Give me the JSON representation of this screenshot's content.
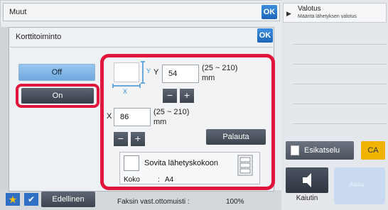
{
  "header": {
    "title": "Muut",
    "ok_label": "OK"
  },
  "right_panel": {
    "valotus_title": "Valotus",
    "valotus_subtitle": "Määritä lähetyksen valotus",
    "preview_label": "Esikatselu",
    "ca_label": "CA",
    "speaker_label": "Kaiutin",
    "start_label": "Aloita"
  },
  "dialog": {
    "title": "Korttitoiminto",
    "ok_label": "OK",
    "off_label": "Off",
    "on_label": "On",
    "y_letter": "Y",
    "y_value": "54",
    "y_range": "(25 ~ 210)",
    "y_unit": "mm",
    "x_letter": "X",
    "x_value": "86",
    "x_range": "(25 ~ 210)",
    "x_unit": "mm",
    "diagram_x": "X",
    "diagram_y": "Y",
    "minus": "−",
    "plus": "+",
    "reset_label": "Palauta",
    "fit_label": "Sovita lähetyskokoon",
    "size_label": "Koko",
    "size_sep": ":",
    "size_value": "A4"
  },
  "bottom_bar": {
    "star": "★",
    "check": "✔",
    "previous_label": "Edellinen",
    "faksin_label": "Faksin vast.ottomuisti :",
    "faksin_value": "100%"
  },
  "colors": {
    "accent": "#1f66b8",
    "highlight": "#e0163c",
    "ca": "#f0b400"
  }
}
